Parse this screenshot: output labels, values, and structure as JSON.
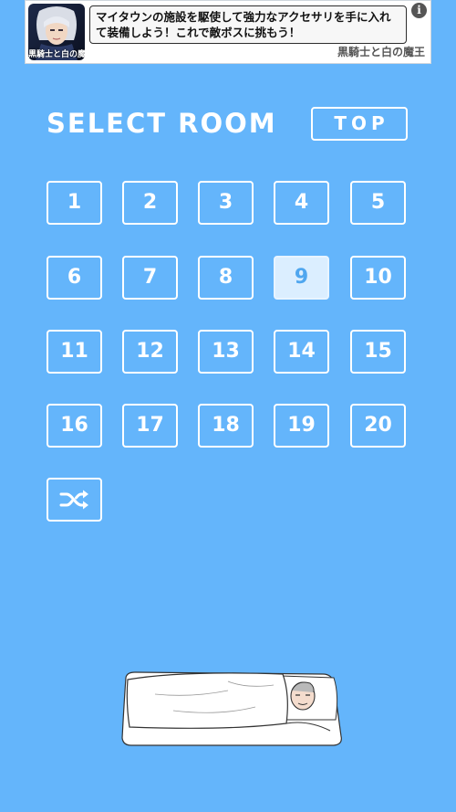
{
  "ad": {
    "thumb_title": "黒騎士と白の魔王",
    "text": "マイタウンの施設を駆使して強力なアクセサリを手に入れて装備しよう！これで敵ボスに挑もう！",
    "sponsor": "黒騎士と白の魔王",
    "info": "i"
  },
  "header": {
    "title": "SELECT ROOM",
    "top_label": "TOP"
  },
  "rooms": [
    "1",
    "2",
    "3",
    "4",
    "5",
    "6",
    "7",
    "8",
    "9",
    "10",
    "11",
    "12",
    "13",
    "14",
    "15",
    "16",
    "17",
    "18",
    "19",
    "20"
  ],
  "selected_room": "9",
  "colors": {
    "background": "#64b5fb",
    "selected_bg": "#dbeeff",
    "selected_text": "#4fa6ef"
  },
  "icons": {
    "shuffle": "shuffle-icon",
    "info": "info-icon"
  }
}
